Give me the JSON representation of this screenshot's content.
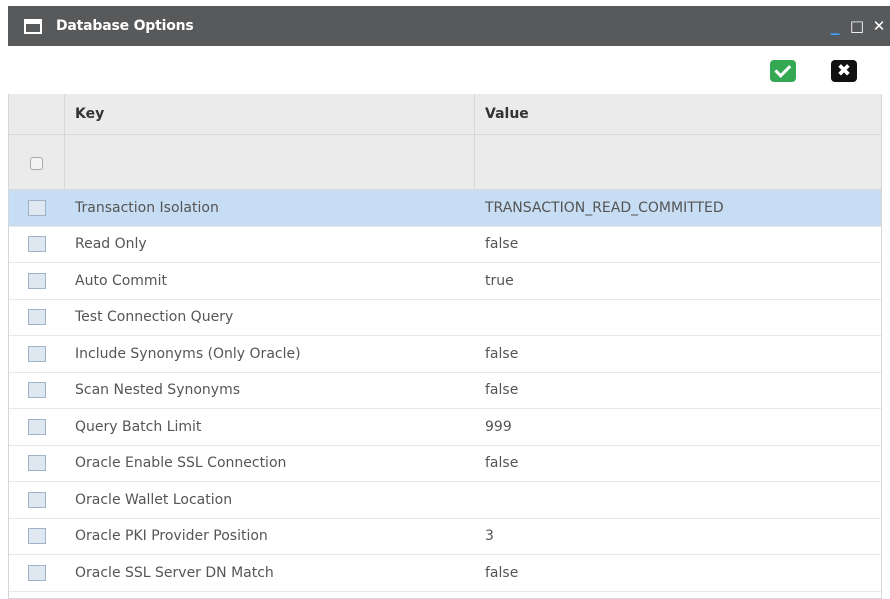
{
  "window": {
    "title": "Database Options",
    "minimize": "_",
    "maximize": "□",
    "close": "✕"
  },
  "toolbar": {
    "confirm_icon": "checkmark-icon",
    "cancel_icon": "close-icon",
    "accent_confirm": "#34a853",
    "accent_cancel": "#111111"
  },
  "grid": {
    "columns": [
      "Key",
      "Value"
    ],
    "rows": [
      {
        "key": "Transaction Isolation",
        "value": "TRANSACTION_READ_COMMITTED",
        "selected": true
      },
      {
        "key": "Read Only",
        "value": "false"
      },
      {
        "key": "Auto Commit",
        "value": "true"
      },
      {
        "key": "Test Connection Query",
        "value": ""
      },
      {
        "key": "Include Synonyms (Only Oracle)",
        "value": "false"
      },
      {
        "key": "Scan Nested Synonyms",
        "value": "false"
      },
      {
        "key": "Query Batch Limit",
        "value": "999"
      },
      {
        "key": "Oracle Enable SSL Connection",
        "value": "false"
      },
      {
        "key": "Oracle Wallet Location",
        "value": ""
      },
      {
        "key": "Oracle PKI Provider Position",
        "value": "3"
      },
      {
        "key": "Oracle SSL Server DN Match",
        "value": "false"
      }
    ]
  }
}
